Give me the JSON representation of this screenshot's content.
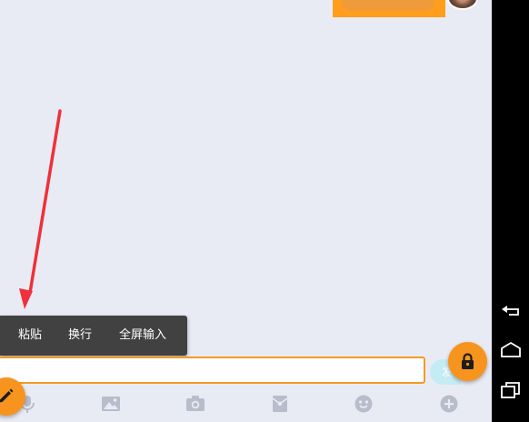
{
  "context_menu": {
    "items": [
      {
        "label": "粘贴"
      },
      {
        "label": "换行"
      },
      {
        "label": "全屏输入"
      }
    ]
  },
  "input": {
    "value": "",
    "placeholder": ""
  },
  "send_button": {
    "label": "发"
  },
  "toolbar": {
    "items": [
      {
        "icon": "microphone-icon"
      },
      {
        "icon": "image-icon"
      },
      {
        "icon": "camera-icon"
      },
      {
        "icon": "red-packet-icon"
      },
      {
        "icon": "emoji-icon"
      },
      {
        "icon": "plus-icon"
      }
    ]
  },
  "colors": {
    "accent": "#f7941e",
    "chat_background": "#e9ebf4",
    "menu_background": "#414141",
    "arrow": "#f0303a",
    "send_button": "#c4ecf4",
    "toolbar_icon": "#b9bccb"
  }
}
